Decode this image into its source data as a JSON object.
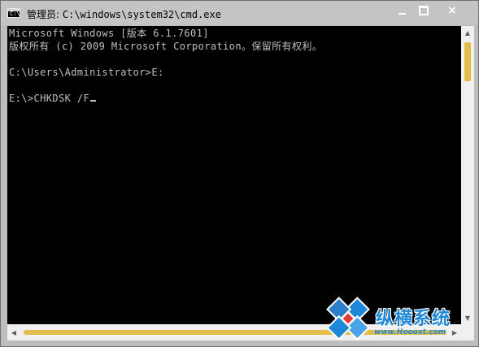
{
  "window": {
    "title_prefix": "管理员:",
    "title_path": "C:\\windows\\system32\\cmd.exe",
    "icon": "cmd-icon",
    "controls": {
      "minimize": "minimize-icon",
      "maximize": "maximize-icon",
      "close": "×"
    }
  },
  "console": {
    "lines": [
      "Microsoft Windows [版本 6.1.7601]",
      "版权所有 (c) 2009 Microsoft Corporation。保留所有权利。",
      "",
      "C:\\Users\\Administrator>E:",
      "",
      "E:\\>CHKDSK /F"
    ],
    "text_color": "#c0c0c0",
    "background": "#000000"
  },
  "scrollbars": {
    "up": "▲",
    "down": "▼",
    "left": "◀",
    "right": "▶",
    "thumb_color": "#e3bd4a"
  },
  "watermark": {
    "text": "纵横系统",
    "url": "www.Hoooxt.com"
  }
}
